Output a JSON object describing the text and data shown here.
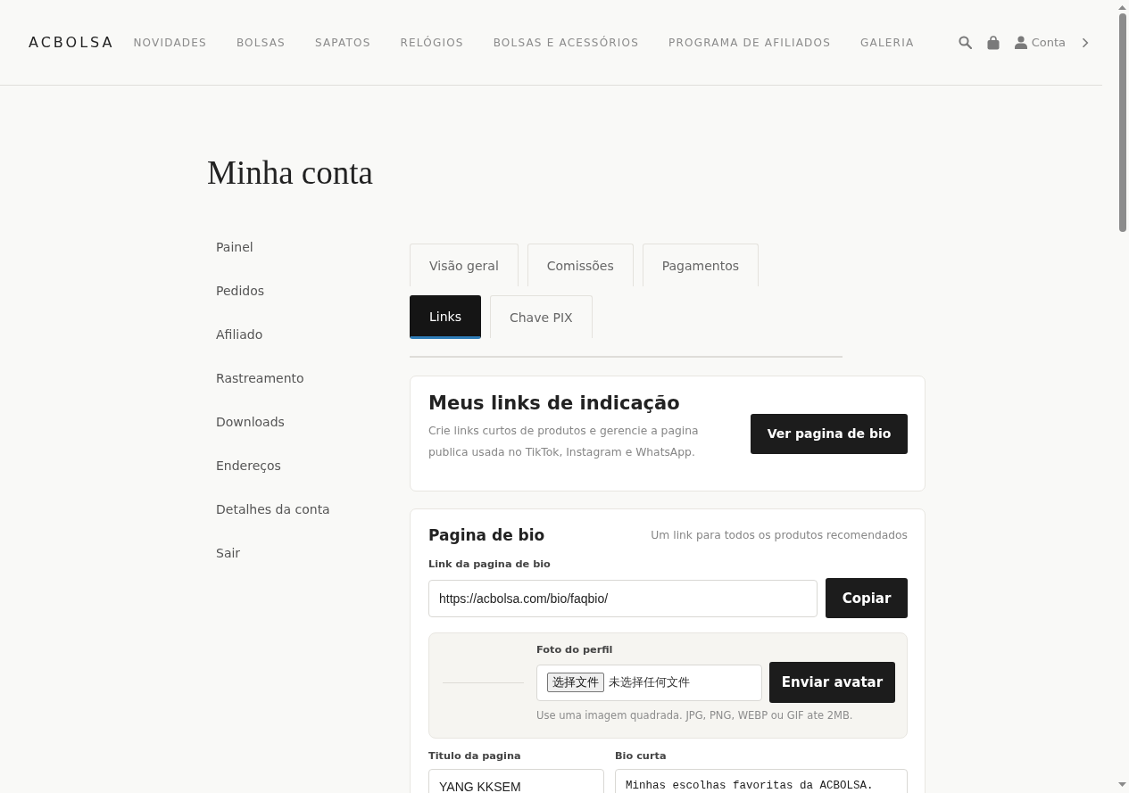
{
  "header": {
    "logo": "ACBOLSA",
    "nav": [
      "NOVIDADES",
      "BOLSAS",
      "SAPATOS",
      "RELÓGIOS",
      "BOLSAS E ACESSÓRIOS",
      "PROGRAMA DE AFILIADOS",
      "GALERIA"
    ],
    "account_label": "Conta"
  },
  "page_title": "Minha conta",
  "sidebar": {
    "items": [
      "Painel",
      "Pedidos",
      "Afiliado",
      "Rastreamento",
      "Downloads",
      "Endereços",
      "Detalhes da conta",
      "Sair"
    ]
  },
  "tabs": [
    {
      "label": "Visão geral",
      "selected": false
    },
    {
      "label": "Comissões",
      "selected": false
    },
    {
      "label": "Pagamentos",
      "selected": false
    },
    {
      "label": "Links",
      "selected": true
    },
    {
      "label": "Chave PIX",
      "selected": false
    }
  ],
  "referral_card": {
    "title": "Meus links de indicação",
    "description": "Crie links curtos de produtos e gerencie a pagina publica usada no TikTok, Instagram e WhatsApp.",
    "button": "Ver pagina de bio"
  },
  "bio_card": {
    "title": "Pagina de bio",
    "note": "Um link para todos os produtos recomendados",
    "link_label": "Link da pagina de bio",
    "link_value": "https://acbolsa.com/bio/faqbio/",
    "copy_button": "Copiar",
    "avatar": {
      "label": "Foto do perfil",
      "file_button": "选择文件",
      "file_status": "未选择任何文件",
      "upload_button": "Enviar avatar",
      "hint": "Use uma imagem quadrada. JPG, PNG, WEBP ou GIF ate 2MB."
    },
    "fields": [
      {
        "kind": "input",
        "label": "Titulo da pagina",
        "value": "YANG KKSEM"
      },
      {
        "kind": "textarea",
        "label": "Bio curta",
        "value": "Minhas escolhas favoritas da ACBOLSA."
      }
    ]
  }
}
